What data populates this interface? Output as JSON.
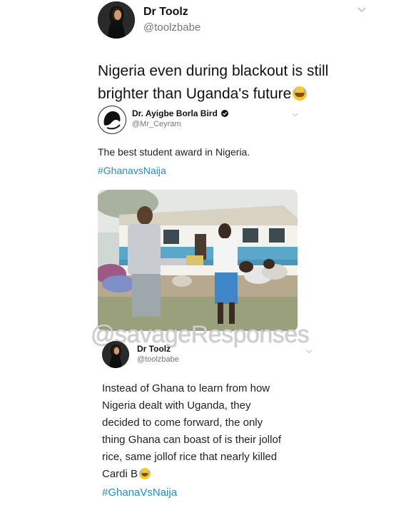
{
  "tweet1": {
    "name": "Dr Toolz",
    "handle": "@toolzbabe",
    "text_line1": "Nigeria even during blackout is still",
    "text_line2": "brighter than Uganda's future",
    "emoji": "face-with-tears-of-joy"
  },
  "quoted": {
    "name": "Dr. Ayigbe Borla Bird",
    "verified": true,
    "handle": "@Mr_Ceyram",
    "text": "The best student award in Nigeria.",
    "hashtag": "#GhanavsNaija"
  },
  "watermark": "@savageResponses",
  "tweet2": {
    "name": "Dr Toolz",
    "handle": "@toolzbabe",
    "lines": [
      "Instead of Ghana to learn from how",
      "Nigeria dealt with Uganda, they",
      "decided to come forward, the only",
      "thing Ghana can boast of is their jollof",
      "rice, same jollof rice that nearly killed",
      "Cardi B"
    ],
    "hashtag": "#GhanaVsNaija"
  },
  "colors": {
    "link": "#1d8fd8",
    "handle": "#777777",
    "background": "#ffffff"
  }
}
